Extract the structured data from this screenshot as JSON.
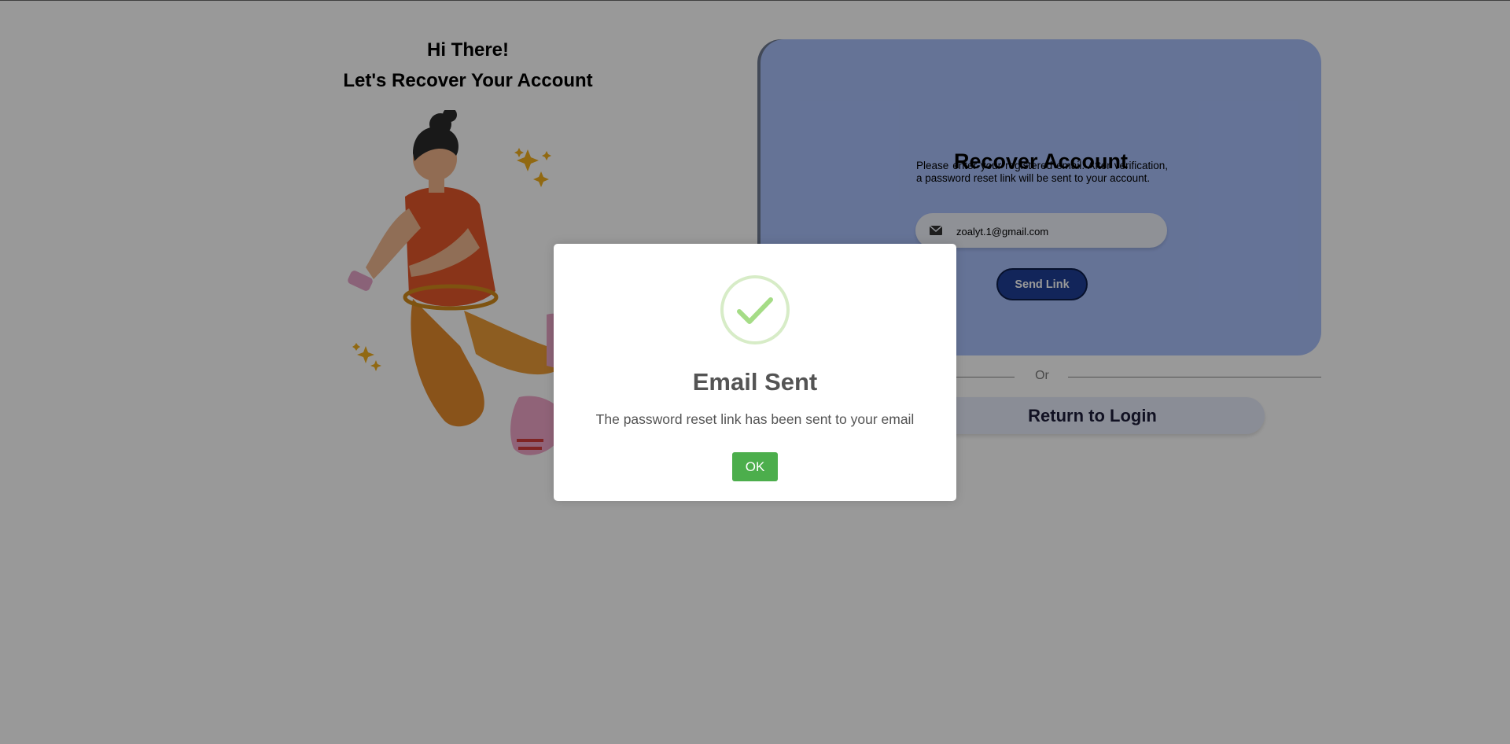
{
  "hero": {
    "line1": "Hi There!",
    "line2": "Let's Recover Your Account"
  },
  "illustration": {
    "name": "woman-jumping-with-phone-illustration",
    "colors": {
      "shirt": "#e5582a",
      "pants": "#e8902e",
      "hair": "#2b2b2b",
      "sparkle": "#f2b01e",
      "shoe": "#f1a6c8"
    }
  },
  "recover_card": {
    "title": "Recover Account",
    "description": "Please enter your registered email. After verification, a password reset link will be sent to your account.",
    "email_icon": "envelope-icon",
    "email_value": "zoalyt.1@gmail.com",
    "send_button_label": "Send Link",
    "background_color": "#a9c0fb",
    "button_color": "#1f3f96"
  },
  "divider": {
    "label": "Or"
  },
  "return_button_label": "Return to Login",
  "modal": {
    "icon": "success-checkmark-icon",
    "title": "Email Sent",
    "message": "The password reset link has been sent to your email",
    "ok_label": "OK",
    "icon_color": "#a5dc86",
    "ok_color": "#4cae4c"
  }
}
